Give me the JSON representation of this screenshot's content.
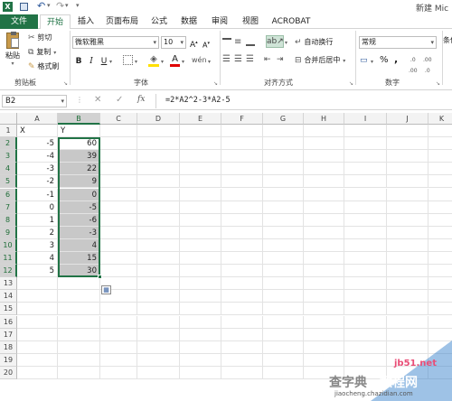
{
  "title": "新建 Mic",
  "tabs": [
    "文件",
    "开始",
    "插入",
    "页面布局",
    "公式",
    "数据",
    "审阅",
    "视图",
    "ACROBAT"
  ],
  "clipboard": {
    "paste": "粘贴",
    "cut": "剪切",
    "copy": "复制",
    "painter": "格式刷",
    "group": "剪贴板"
  },
  "font": {
    "name": "微软雅黑",
    "size": "10",
    "bold": "B",
    "italic": "I",
    "underline": "U",
    "group": "字体"
  },
  "alignment": {
    "wrap": "自动换行",
    "merge": "合并后居中",
    "group": "对齐方式"
  },
  "number": {
    "format": "常规",
    "percent": "%",
    "comma": ",",
    "group": "数字"
  },
  "styles": {
    "cond": "条件格"
  },
  "namebox": "B2",
  "formula": "=2*A2^2-3*A2-5",
  "columns": [
    "A",
    "B",
    "C",
    "D",
    "E",
    "F",
    "G",
    "H",
    "I",
    "J",
    "K"
  ],
  "rows": [
    "1",
    "2",
    "3",
    "4",
    "5",
    "6",
    "7",
    "8",
    "9",
    "10",
    "11",
    "12",
    "13",
    "14",
    "15",
    "16",
    "17",
    "18",
    "19",
    "20"
  ],
  "header_row": {
    "a": "X",
    "b": "Y"
  },
  "data": [
    {
      "x": "-5",
      "y": "60"
    },
    {
      "x": "-4",
      "y": "39"
    },
    {
      "x": "-3",
      "y": "22"
    },
    {
      "x": "-2",
      "y": "9"
    },
    {
      "x": "-1",
      "y": "0"
    },
    {
      "x": "0",
      "y": "-5"
    },
    {
      "x": "1",
      "y": "-6"
    },
    {
      "x": "2",
      "y": "-3"
    },
    {
      "x": "3",
      "y": "4"
    },
    {
      "x": "4",
      "y": "15"
    },
    {
      "x": "5",
      "y": "30"
    }
  ],
  "watermark": {
    "brand": "查字典",
    "site": "教程网",
    "domain": "jb51.net",
    "url": "jiaocheng.chazidian.com"
  },
  "colors": {
    "excel_green": "#217346",
    "accent": "#1e6d37",
    "selection": "#c8c8c8"
  }
}
